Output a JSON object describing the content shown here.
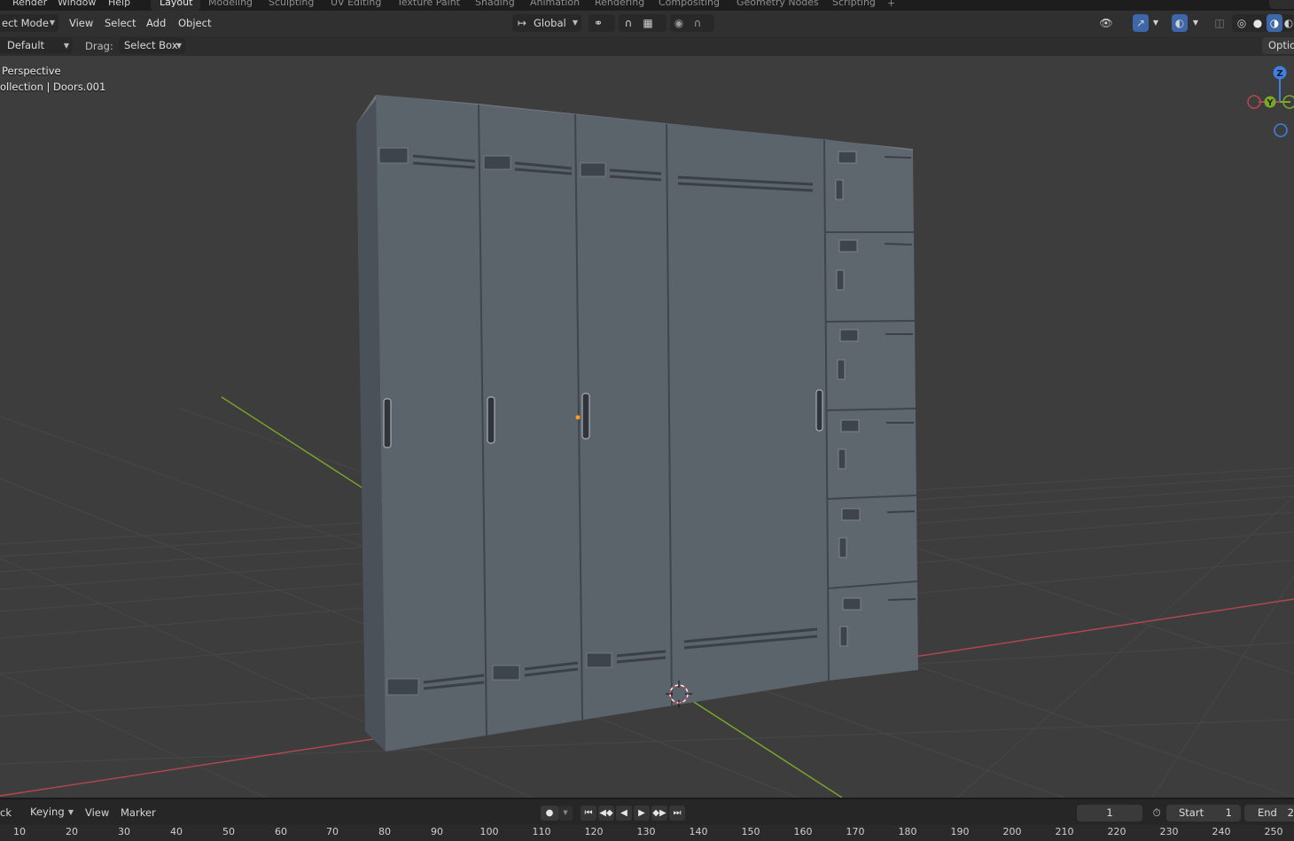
{
  "topbar": {
    "menus": [
      "Render",
      "Window",
      "Help"
    ],
    "workspaces": [
      "Layout",
      "Modeling",
      "Sculpting",
      "UV Editing",
      "Texture Paint",
      "Shading",
      "Animation",
      "Rendering",
      "Compositing",
      "Geometry Nodes",
      "Scripting"
    ],
    "active_workspace": "Layout",
    "add_tab": "+"
  },
  "header": {
    "mode": "ect Mode",
    "menus": [
      "View",
      "Select",
      "Add",
      "Object"
    ],
    "orientation": "Global"
  },
  "tool_settings": {
    "orientation_label": "Default",
    "drag_label": "Drag:",
    "drag_value": "Select Box",
    "options": "Optio"
  },
  "viewport": {
    "view_name": "Perspective",
    "collection_info": "ollection | Doors.001",
    "gizmo": {
      "z": "Z",
      "y": "Y"
    },
    "colors": {
      "background": "#3d3d3d",
      "x_axis": "#b4474f",
      "y_axis": "#7aa829",
      "locker": "#5b636b"
    }
  },
  "timeline": {
    "menus": [
      "ck",
      "Keying",
      "View",
      "Marker"
    ],
    "current_frame": "1",
    "start_label": "Start",
    "start_value": "1",
    "end_label": "End",
    "end_value": "2"
  },
  "ruler": {
    "ticks": [
      "10",
      "20",
      "30",
      "40",
      "50",
      "60",
      "70",
      "80",
      "90",
      "100",
      "110",
      "120",
      "130",
      "140",
      "150",
      "160",
      "170",
      "180",
      "190",
      "200",
      "210",
      "220",
      "230",
      "240",
      "250"
    ]
  }
}
